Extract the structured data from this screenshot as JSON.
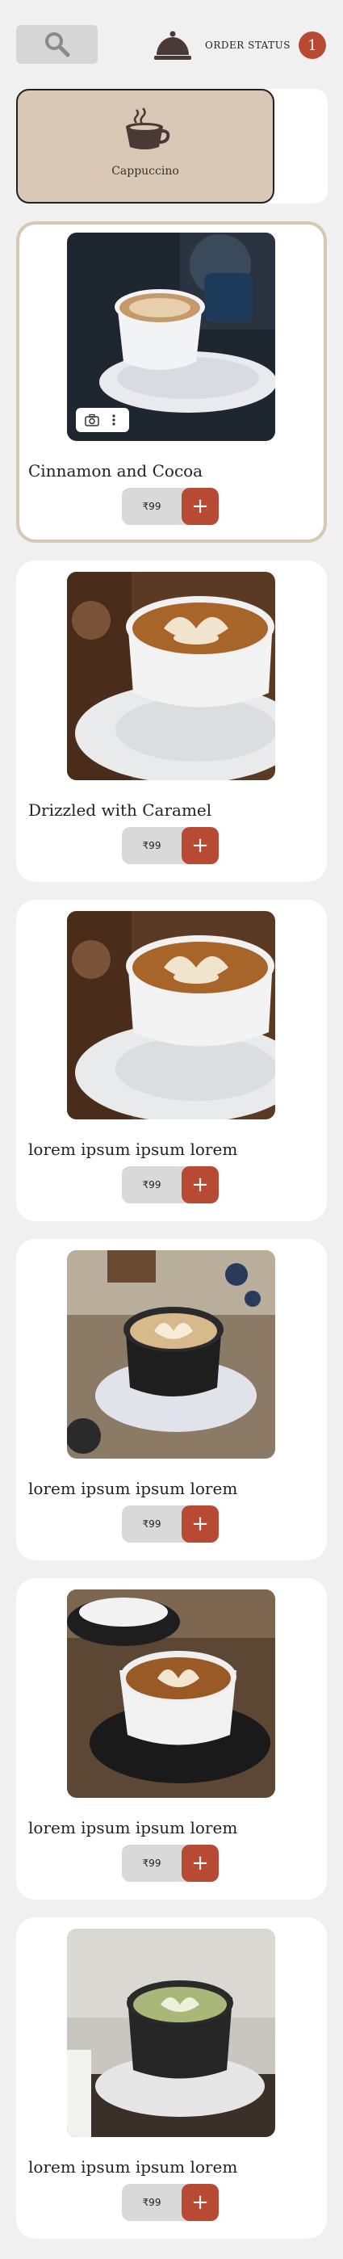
{
  "header": {
    "search_icon": "search-icon",
    "order_icon": "cloche-icon",
    "order_label": "ORDER STATUS",
    "order_count": "1"
  },
  "categories": [
    {
      "label": "Cappuccino",
      "icon": "coffee-cup-icon",
      "selected": true
    }
  ],
  "products": [
    {
      "title": "Cinnamon and Cocoa",
      "price": "₹99",
      "add_label": "+",
      "selected": true,
      "photo": "cappuccino on saucer, dark background"
    },
    {
      "title": "Drizzled with Caramel",
      "price": "₹99",
      "add_label": "+",
      "selected": false,
      "photo": "latte art on wooden table"
    },
    {
      "title": "lorem ipsum ipsum lorem",
      "price": "₹99",
      "add_label": "+",
      "selected": false,
      "photo": "latte art on wooden table"
    },
    {
      "title": "lorem ipsum ipsum lorem",
      "price": "₹99",
      "add_label": "+",
      "selected": false,
      "photo": "latte art with coffee beans"
    },
    {
      "title": "lorem ipsum ipsum lorem",
      "price": "₹99",
      "add_label": "+",
      "selected": false,
      "photo": "latte in black cup"
    },
    {
      "title": "lorem ipsum ipsum lorem",
      "price": "₹99",
      "add_label": "+",
      "selected": false,
      "photo": "matcha latte"
    }
  ],
  "colors": {
    "accent": "#b84a33",
    "category_bg": "#d9c8b5",
    "pill_bg": "#d9d9d9",
    "page_bg": "#f0f0f0"
  }
}
